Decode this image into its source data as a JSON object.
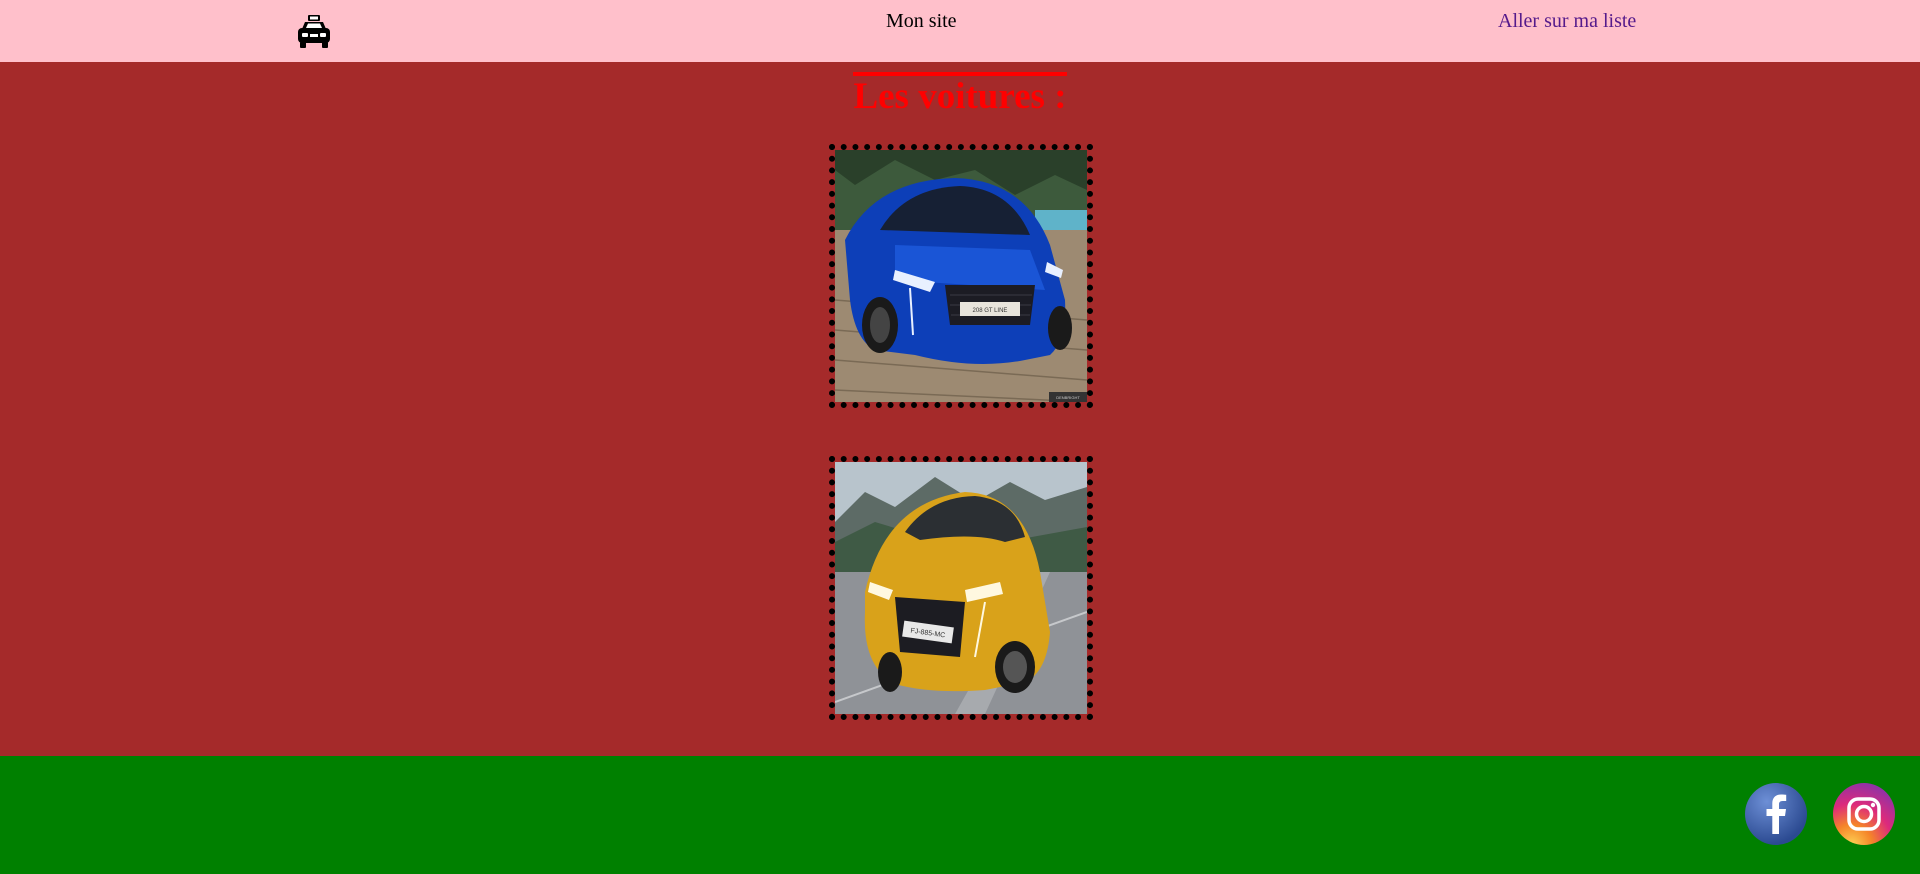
{
  "header": {
    "logo_icon": "taxi-icon",
    "site_title": "Mon site",
    "list_link": "Aller sur ma liste"
  },
  "main": {
    "heading": "Les voitures :",
    "cars": [
      {
        "image": "blue-car-photo",
        "plate": "208 GT LINE",
        "watermark": "DENBRIGHT"
      },
      {
        "image": "yellow-car-photo",
        "plate": "FJ-885-MC"
      }
    ]
  },
  "footer": {
    "social": [
      {
        "icon": "facebook-icon",
        "label": "f"
      },
      {
        "icon": "instagram-icon"
      }
    ]
  },
  "colors": {
    "header_bg": "#ffc0cb",
    "main_bg": "#a52a2a",
    "heading": "#ff0000",
    "footer_bg": "#008000",
    "link": "#551a8b"
  }
}
